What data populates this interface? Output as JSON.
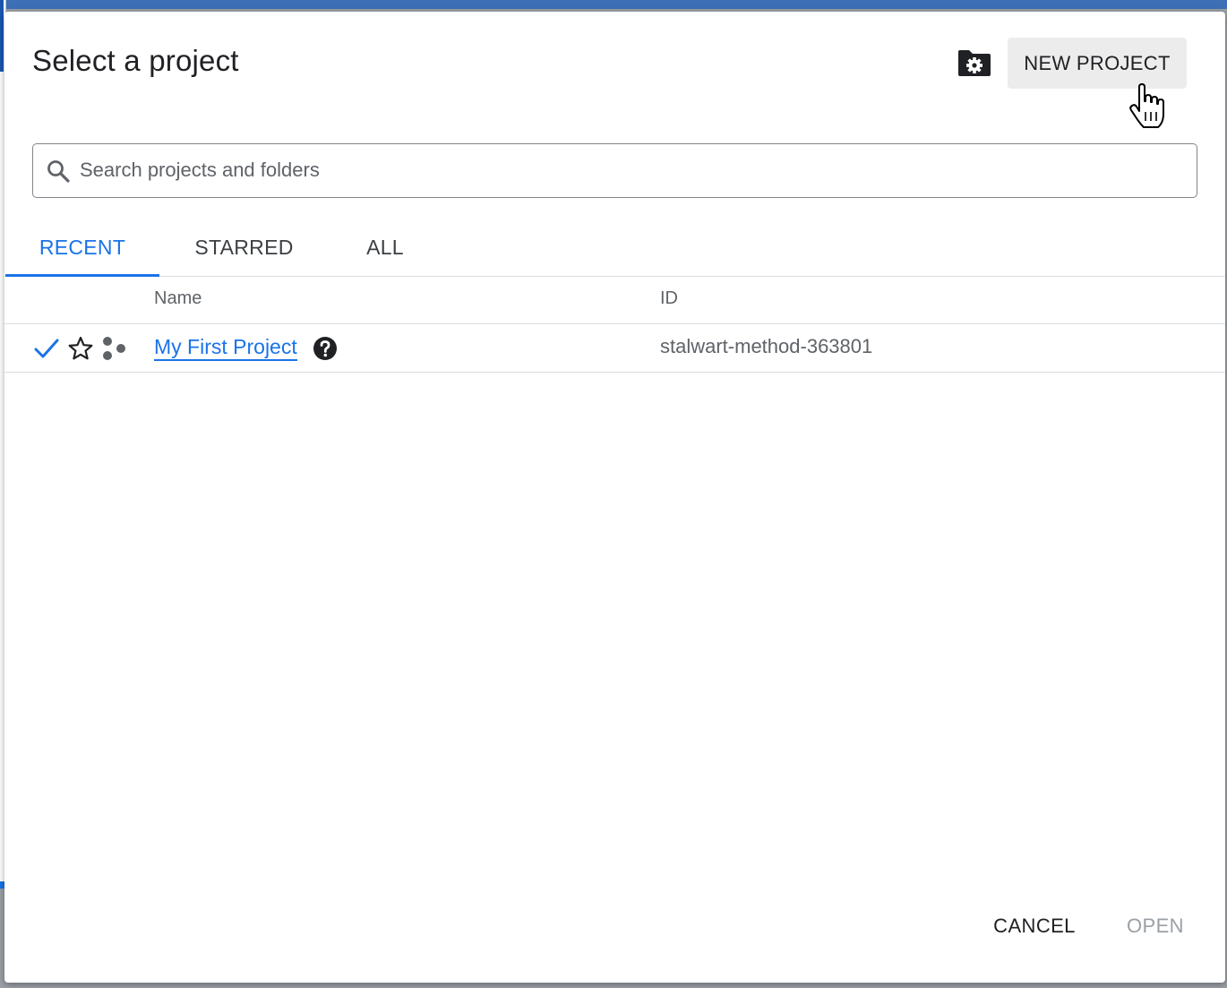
{
  "dialog": {
    "title": "Select a project",
    "new_project_label": "NEW PROJECT",
    "folder_settings_icon": "folder-settings-icon"
  },
  "search": {
    "placeholder": "Search projects and folders",
    "value": ""
  },
  "tabs": [
    {
      "label": "RECENT",
      "active": true
    },
    {
      "label": "STARRED",
      "active": false
    },
    {
      "label": "ALL",
      "active": false
    }
  ],
  "table": {
    "columns": [
      "Name",
      "ID"
    ],
    "rows": [
      {
        "selected": true,
        "starred": false,
        "name": "My First Project",
        "id": "stalwart-method-363801"
      }
    ]
  },
  "footer": {
    "cancel_label": "CANCEL",
    "open_label": "OPEN",
    "open_enabled": false
  },
  "colors": {
    "accent": "#1a73e8",
    "text": "#202124",
    "muted": "#5f6368",
    "divider": "#dadce0",
    "disabled": "#9aa0a6"
  }
}
